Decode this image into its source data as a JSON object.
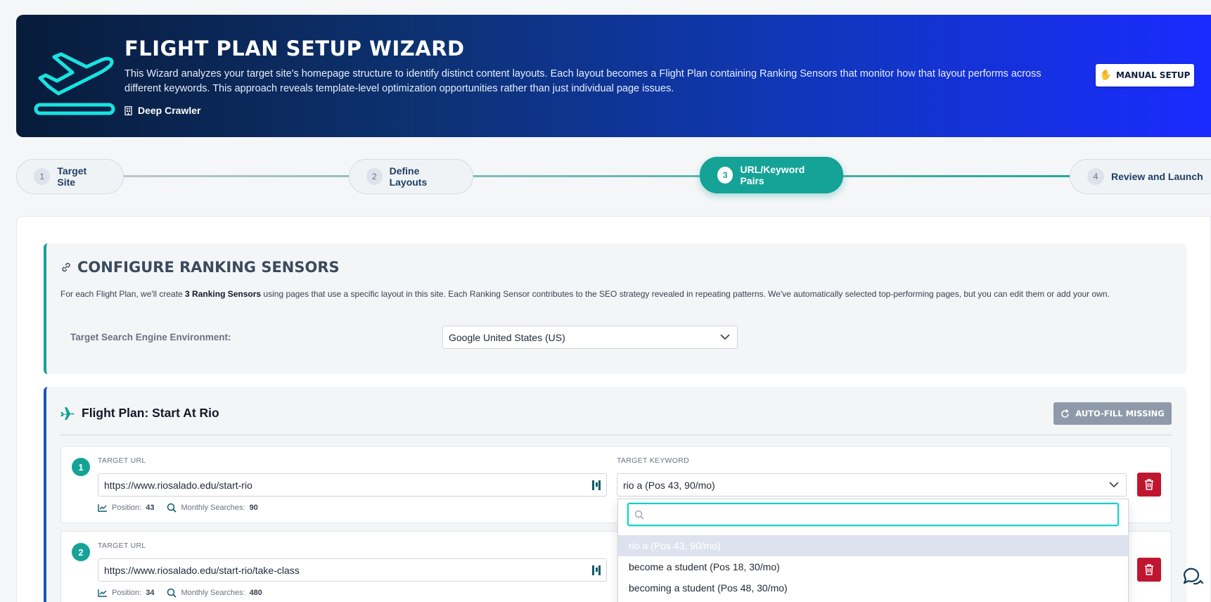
{
  "header": {
    "title": "Flight Plan Setup Wizard",
    "description": "This Wizard analyzes your target site's homepage structure to identify distinct content layouts. Each layout becomes a Flight Plan containing Ranking Sensors that monitor how that layout performs across different keywords. This approach reveals template-level optimization opportunities rather than just individual page issues.",
    "crawler_label": "Deep Crawler",
    "manual_setup_label": "Manual Setup",
    "gradient_colors": [
      "#081c3a",
      "#1a2bff"
    ]
  },
  "steps": [
    {
      "number": "1",
      "label": "Target Site",
      "active": false
    },
    {
      "number": "2",
      "label": "Define Layouts",
      "active": false
    },
    {
      "number": "3",
      "label": "URL/Keyword Pairs",
      "active": true
    },
    {
      "number": "4",
      "label": "Review and Launch",
      "active": false
    }
  ],
  "configure": {
    "title": "Configure Ranking Sensors",
    "desc_before": "For each Flight Plan, we'll create ",
    "desc_bold": "3 Ranking Sensors",
    "desc_after": " using pages that use a specific layout in this site. Each Ranking Sensor contributes to the SEO strategy revealed in repeating patterns. We've automatically selected top-performing pages, but you can edit them or add your own.",
    "env_label": "Target Search Engine Environment:",
    "env_value": "Google United States (US)"
  },
  "flight_plan": {
    "title": "Flight Plan: Start At Rio",
    "autofill_label": "Auto-fill Missing",
    "url_label": "TARGET URL",
    "keyword_label": "TARGET KEYWORD",
    "position_label": "Position:",
    "searches_label": "Monthly Searches:",
    "sensors": [
      {
        "number": "1",
        "url": "https://www.riosalado.edu/start-rio",
        "keyword": "rio a (Pos 43, 90/mo)",
        "position": "43",
        "searches": "90"
      },
      {
        "number": "2",
        "url": "https://www.riosalado.edu/start-rio/take-class",
        "keyword": "",
        "position": "34",
        "searches": "480"
      }
    ]
  },
  "dropdown": {
    "search_placeholder": "",
    "options": [
      "rio a (Pos 43, 90/mo)",
      "become a student (Pos 18, 30/mo)",
      "becoming a student (Pos 48, 30/mo)"
    ]
  },
  "colors": {
    "accent_teal": "#14a396",
    "delete_red": "#c0152f",
    "plan_border_blue": "#1a56b8"
  }
}
